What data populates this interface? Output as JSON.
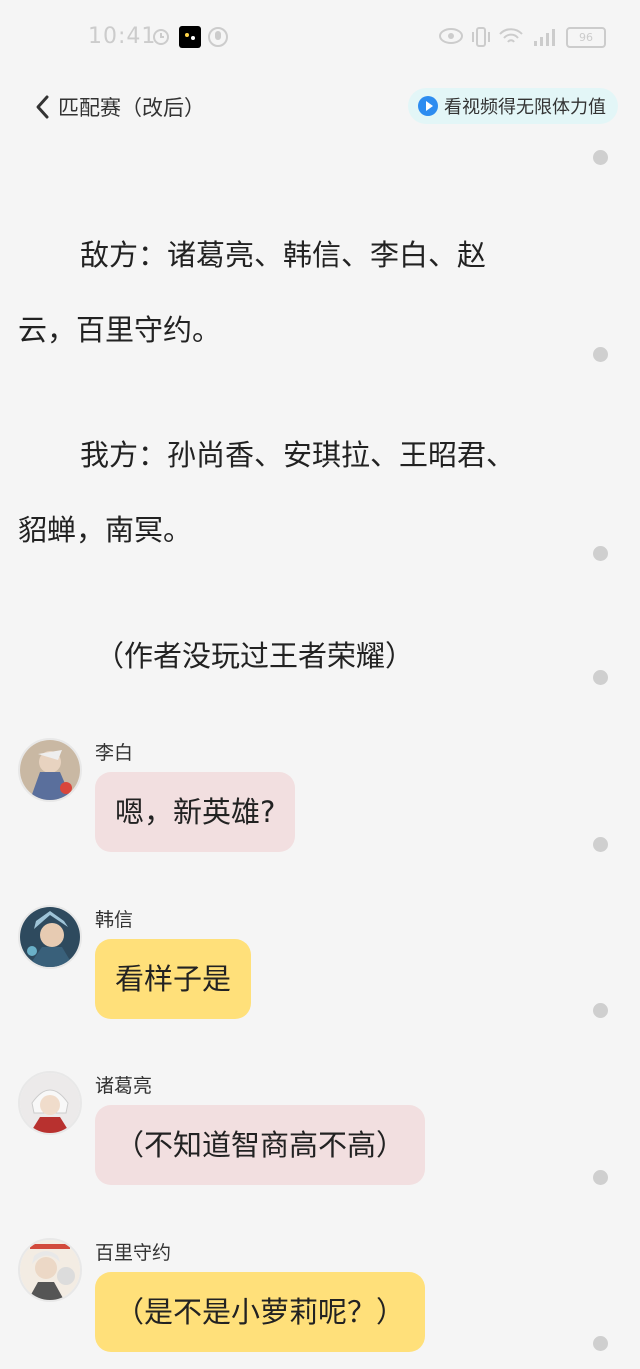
{
  "status_bar": {
    "time": "10:41",
    "battery": "96"
  },
  "header": {
    "title": "匹配赛（改后）",
    "video_pill_label": "看视频得无限体力值"
  },
  "story": {
    "enemy_line1": "敌方：诸葛亮、韩信、李白、赵",
    "enemy_line2": "云，百里守约。",
    "ally_line1": "我方：孙尚香、安琪拉、王昭君、",
    "ally_line2": "貂蝉，南冥。",
    "note": "（作者没玩过王者荣耀）"
  },
  "messages": [
    {
      "sender": "李白",
      "text": "嗯，新英雄?",
      "bubble_color": "#f2dfe0"
    },
    {
      "sender": "韩信",
      "text": "看样子是",
      "bubble_color": "#ffe07a"
    },
    {
      "sender": "诸葛亮",
      "text": "（不知道智商高不高）",
      "bubble_color": "#f2dfe0"
    },
    {
      "sender": "百里守约",
      "text": "（是不是小萝莉呢？）",
      "bubble_color": "#ffe07a"
    }
  ],
  "icons": [
    "back-chevron-icon",
    "play-circle-icon",
    "avatar-libai",
    "avatar-hanxin",
    "avatar-zhuge",
    "avatar-baili"
  ]
}
